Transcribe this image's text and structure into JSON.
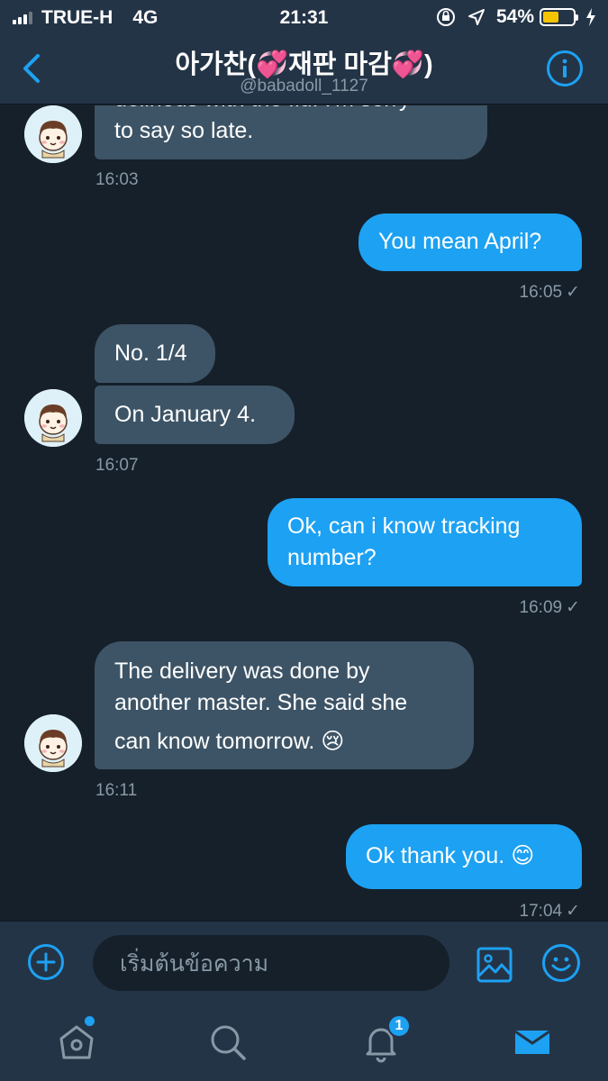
{
  "status_bar": {
    "carrier": "TRUE-H",
    "network": "4G",
    "time": "21:31",
    "battery": "54%",
    "battery_level": 0.54
  },
  "header": {
    "title": "아가찬(💞재판 마감💞)",
    "handle": "@babadoll_1127"
  },
  "messages": [
    {
      "dir": "in",
      "lines": [
        "delirious with the flu. I'm sorry",
        "to say so late."
      ],
      "time": "16:03"
    },
    {
      "dir": "out",
      "lines": [
        "You mean April?"
      ],
      "time": "16:05"
    },
    {
      "dir": "in",
      "lines": [
        "No. 1/4"
      ]
    },
    {
      "dir": "in",
      "lines": [
        "On January 4."
      ],
      "time": "16:07"
    },
    {
      "dir": "out",
      "lines": [
        "Ok, can i know tracking",
        "number?"
      ],
      "time": "16:09"
    },
    {
      "dir": "in",
      "lines": [
        "The delivery was done by",
        "another master. She said she",
        "can know tomorrow. 😢"
      ],
      "time": "16:11"
    },
    {
      "dir": "out",
      "lines": [
        "Ok thank you. 😊"
      ],
      "time": "17:04"
    }
  ],
  "composer": {
    "placeholder": "เริ่มต้นข้อความ"
  },
  "tabs": {
    "notifications_badge": "1"
  },
  "colors": {
    "accent": "#1da1f2",
    "background": "#15202b",
    "bar": "#243447",
    "incoming_bubble": "#3d5466"
  },
  "icons": [
    "back-chevron-icon",
    "info-icon",
    "add-icon",
    "image-icon",
    "emoji-icon",
    "home-icon",
    "search-icon",
    "bell-icon",
    "mail-icon"
  ]
}
